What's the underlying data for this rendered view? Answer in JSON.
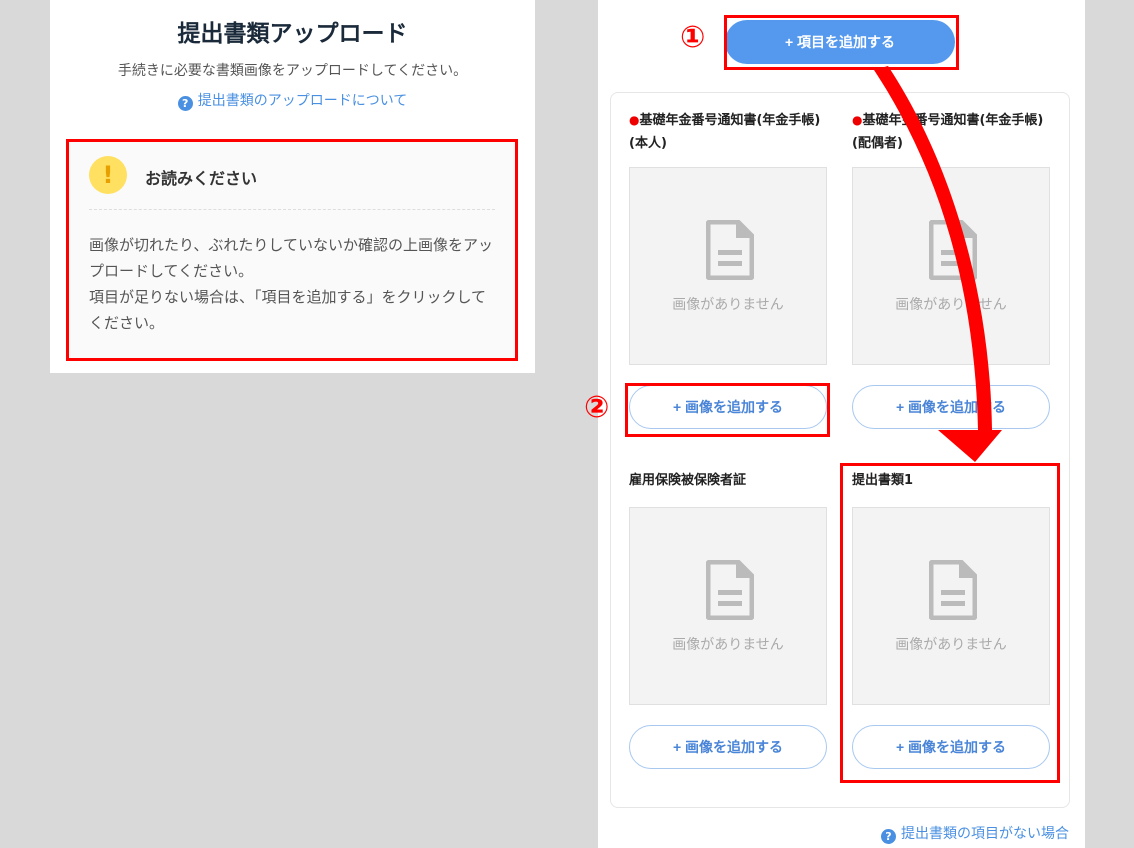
{
  "left": {
    "title": "提出書類アップロード",
    "subtitle": "手続きに必要な書類画像をアップロードしてください。",
    "help_link": "提出書類のアップロードについて",
    "notice": {
      "title": "お読みください",
      "body1": "画像が切れたり、ぶれたりしていないか確認の上画像をアップロードしてください。",
      "body2": "項目が足りない場合は、「項目を追加する」をクリックしてください。"
    }
  },
  "right": {
    "add_item_button": "+ 項目を追加する",
    "items": [
      {
        "label": "基礎年金番号通知書(年金手帳)(本人)",
        "required": true,
        "placeholder": "画像がありません",
        "button": "+ 画像を追加する"
      },
      {
        "label": "基礎年金番号通知書(年金手帳)(配偶者)",
        "required": true,
        "placeholder": "画像がありません",
        "button": "+ 画像を追加する"
      },
      {
        "label": "雇用保険被保険者証",
        "required": false,
        "placeholder": "画像がありません",
        "button": "+ 画像を追加する"
      },
      {
        "label": "提出書類1",
        "required": false,
        "placeholder": "画像がありません",
        "button": "+ 画像を追加する"
      }
    ],
    "footer_link": "提出書類の項目がない場合"
  },
  "annotations": {
    "step1": "①",
    "step2": "②"
  },
  "colors": {
    "accent": "#5599ee",
    "highlight": "#ff0000",
    "warning": "#ffe060"
  }
}
